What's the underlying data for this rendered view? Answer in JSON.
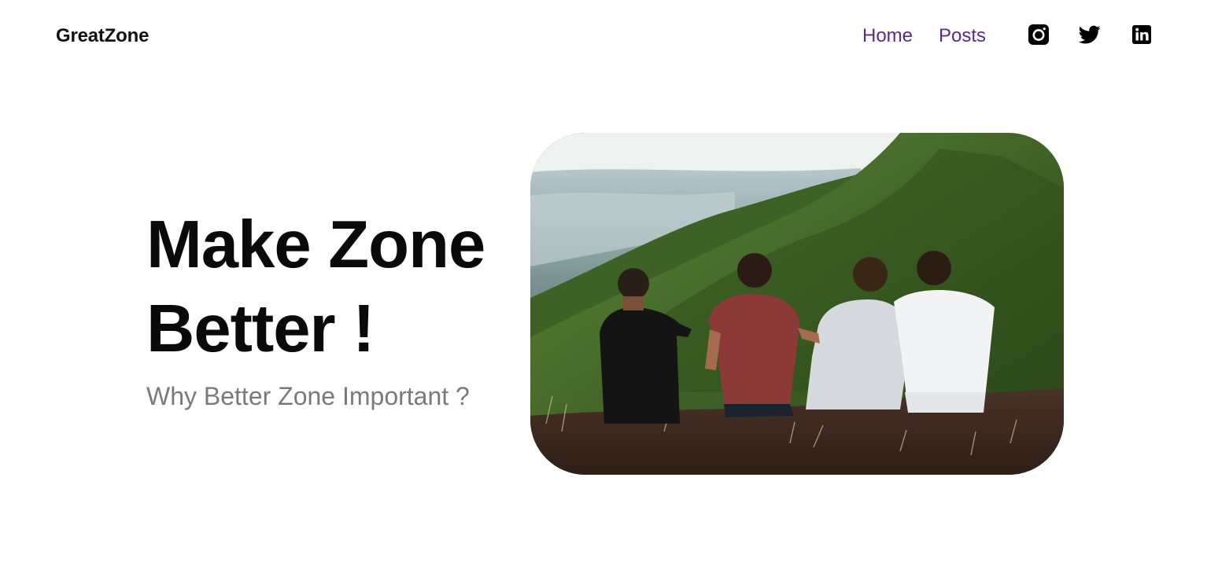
{
  "brand": {
    "name": "GreatZone"
  },
  "nav": {
    "links": [
      {
        "label": "Home"
      },
      {
        "label": "Posts"
      }
    ],
    "social": [
      {
        "icon": "instagram-icon"
      },
      {
        "icon": "twitter-icon"
      },
      {
        "icon": "linkedin-icon"
      }
    ]
  },
  "hero": {
    "title_line1": "Make Zone",
    "title_line2": "Better !",
    "subtitle": "Why Better Zone Important ?",
    "image": {
      "subject": "four friends sitting on a grassy mountain ridge"
    }
  },
  "colors": {
    "nav_link": "#5b2a86",
    "title": "#0a0a0a",
    "subtitle": "#7a7a7a",
    "brand": "#111111"
  }
}
